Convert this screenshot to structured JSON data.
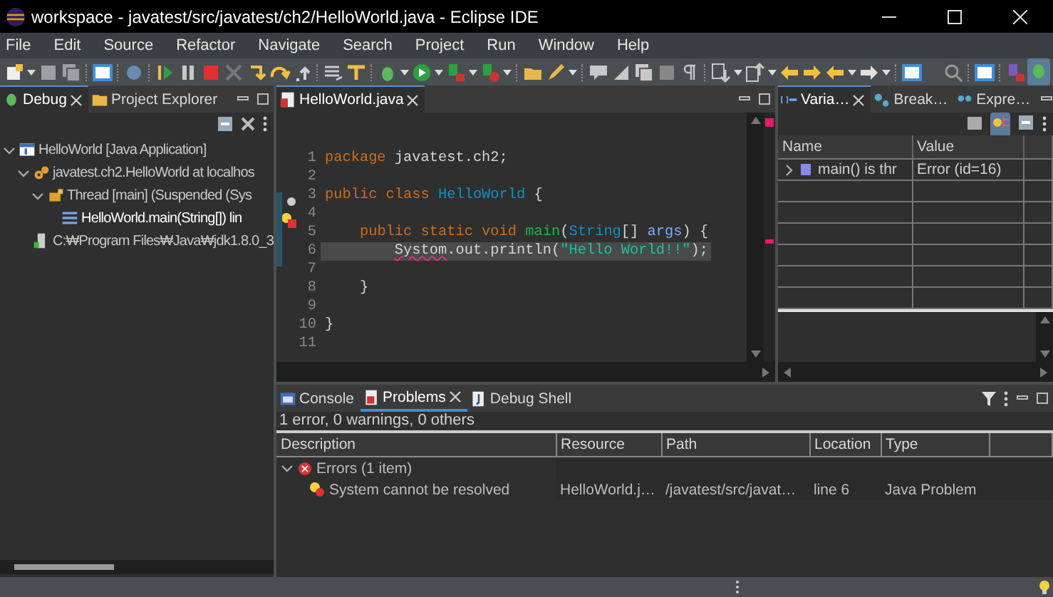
{
  "window": {
    "title": "workspace - javatest/src/javatest/ch2/HelloWorld.java - Eclipse IDE"
  },
  "menu": [
    "File",
    "Edit",
    "Source",
    "Refactor",
    "Navigate",
    "Search",
    "Project",
    "Run",
    "Window",
    "Help"
  ],
  "debug_view": {
    "tabs": [
      {
        "label": "Debug",
        "selected": true
      },
      {
        "label": "Project Explorer",
        "selected": false
      }
    ],
    "tree": [
      {
        "label": "HelloWorld [Java Application]",
        "kind": "launch",
        "expanded": true,
        "selected": false,
        "children": [
          {
            "label": "javatest.ch2.HelloWorld at localhos",
            "kind": "target",
            "expanded": true,
            "selected": false,
            "children": [
              {
                "label": "Thread [main] (Suspended (Sys",
                "kind": "thread",
                "expanded": true,
                "selected": false,
                "children": [
                  {
                    "label": "HelloWorld.main(String[]) lin",
                    "kind": "frame",
                    "selected": true
                  }
                ]
              }
            ]
          },
          {
            "label": "C:₩Program Files₩Java₩jdk1.8.0_3",
            "kind": "process",
            "selected": false
          }
        ]
      }
    ]
  },
  "editor": {
    "tab": {
      "label": "HelloWorld.java",
      "selected": true
    },
    "lines": [
      {
        "number": "1",
        "current": false,
        "tokens": [
          {
            "text": "package",
            "kind": "keyword"
          },
          {
            "text": " javatest.ch2;",
            "kind": "plain"
          }
        ]
      },
      {
        "number": "2",
        "current": false
      },
      {
        "number": "3",
        "current": false,
        "tokens": [
          {
            "text": "public class ",
            "kind": "keyword"
          },
          {
            "text": "HelloWorld",
            "kind": "class"
          },
          {
            "text": " {",
            "kind": "plain"
          }
        ]
      },
      {
        "number": "4",
        "current": false
      },
      {
        "number": "5",
        "current": false,
        "marker": {
          "kind": "override"
        },
        "tokens": [
          {
            "text": "    public static void ",
            "kind": "keyword"
          },
          {
            "text": "main",
            "kind": "method"
          },
          {
            "text": "(",
            "kind": "plain"
          },
          {
            "text": "String",
            "kind": "class"
          },
          {
            "text": "[] ",
            "kind": "plain"
          },
          {
            "text": "args",
            "kind": "param"
          },
          {
            "text": ") {",
            "kind": "plain"
          }
        ]
      },
      {
        "number": "6",
        "current": true,
        "marker": {
          "kind": "error"
        },
        "tokens": [
          {
            "text": "        Systom",
            "kind": "unresolved"
          },
          {
            "text": ".out.println(",
            "kind": "plain"
          },
          {
            "text": "\"Hello World!!\"",
            "kind": "string"
          },
          {
            "text": ");",
            "kind": "plain"
          }
        ]
      },
      {
        "number": "7",
        "current": false
      },
      {
        "number": "8",
        "current": false,
        "tokens": [
          {
            "text": "    }",
            "kind": "plain"
          }
        ]
      },
      {
        "number": "9",
        "current": false
      },
      {
        "number": "10",
        "current": false,
        "tokens": [
          {
            "text": "}",
            "kind": "plain"
          }
        ]
      },
      {
        "number": "11",
        "current": false
      }
    ]
  },
  "variables_view": {
    "tabs": [
      {
        "label": "Varia…",
        "selected": true
      },
      {
        "label": "Break…",
        "selected": false
      },
      {
        "label": "Expre…",
        "selected": false
      }
    ],
    "toolbar": [
      {
        "on": false
      },
      {
        "on": true
      },
      {
        "on": false
      }
    ],
    "columns": [
      "Name",
      "Value"
    ],
    "rows": [
      {
        "name": "main() is thr",
        "value": "Error  (id=16)",
        "expanded": false
      }
    ]
  },
  "problems_view": {
    "tabs": [
      {
        "label": "Console",
        "selected": false
      },
      {
        "label": "Problems",
        "selected": true
      },
      {
        "label": "Debug Shell",
        "selected": false
      }
    ],
    "summary": "1 error, 0 warnings, 0 others",
    "columns": [
      "Description",
      "Resource",
      "Path",
      "Location",
      "Type"
    ],
    "groups": [
      {
        "label": "Errors (1 item)",
        "expanded": true,
        "items": [
          {
            "description": "System cannot be resolved",
            "resource": "HelloWorld.j…",
            "path": "/javatest/src/javat…",
            "location": "line 6",
            "type": "Java Problem"
          }
        ]
      }
    ]
  }
}
